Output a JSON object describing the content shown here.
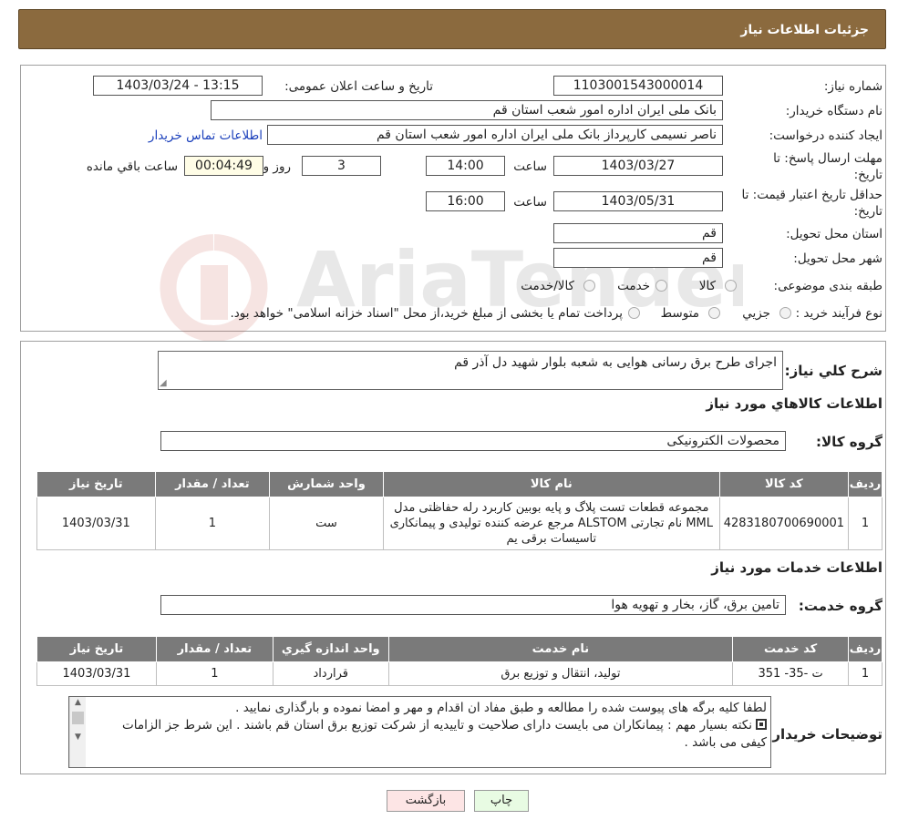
{
  "header": {
    "title": "جزئیات اطلاعات نیاز"
  },
  "need_info": {
    "need_number_label": "شماره نیاز:",
    "need_number": "1103001543000014",
    "announce_label": "تاریخ و ساعت اعلان عمومی:",
    "announce_value": "1403/03/24 - 13:15",
    "buyer_org_label": "نام دستگاه خریدار:",
    "buyer_org": "بانک ملی ایران اداره امور شعب استان قم",
    "creator_label": "ایجاد کننده درخواست:",
    "creator": "ناصر  نسیمی  کارپرداز  بانک ملی ایران اداره امور شعب استان قم",
    "contact_link": "اطلاعات تماس خریدار",
    "deadline_label": "مهلت ارسال پاسخ: تا تاریخ:",
    "deadline_date": "1403/03/27",
    "time_word": "ساعت",
    "deadline_time": "14:00",
    "days": "3",
    "days_word": "روز و",
    "remaining": "00:04:49",
    "remaining_word": "ساعت باقي مانده",
    "validity_label": "حداقل تاریخ اعتبار قیمت: تا تاریخ:",
    "validity_date": "1403/05/31",
    "validity_time": "16:00",
    "province_label": "استان محل تحویل:",
    "province": "قم",
    "city_label": "شهر محل تحویل:",
    "city": "قم",
    "category_label": "طبقه بندی موضوعی:",
    "category_options": [
      "کالا",
      "خدمت",
      "کالا/خدمت"
    ],
    "process_label": "نوع فرآیند خرید :",
    "process_options": [
      "جزيي",
      "متوسط"
    ],
    "process_note": "پرداخت تمام یا بخشی از مبلغ خرید،از محل \"اسناد خزانه اسلامی\" خواهد بود."
  },
  "description": {
    "label": "شرح کلي نياز:",
    "value": "اجرای طرح برق رسانی هوایی به شعبه بلوار شهید دل آذر قم"
  },
  "goods": {
    "section_title": "اطلاعات کالاهاي مورد نياز",
    "group_label": "گروه کالا:",
    "group_value": "محصولات الکترونیکی",
    "columns": [
      "رديف",
      "کد کالا",
      "نام کالا",
      "واحد شمارش",
      "تعداد / مقدار",
      "تاريخ نياز"
    ],
    "rows": [
      {
        "row": "1",
        "code": "4283180700690001",
        "name": "مجموعه قطعات تست پلاگ و پایه بوبین کاربرد رله حفاظتی مدل MML نام تجارتی ALSTOM مرجع عرضه کننده تولیدی و پیمانکاری تاسیسات برقی یم",
        "unit": "ست",
        "qty": "1",
        "date": "1403/03/31"
      }
    ]
  },
  "services": {
    "section_title": "اطلاعات خدمات مورد نياز",
    "group_label": "گروه خدمت:",
    "group_value": "تامین برق، گاز، بخار و تهویه هوا",
    "columns": [
      "رديف",
      "کد خدمت",
      "نام خدمت",
      "واحد اندازه گيري",
      "تعداد / مقدار",
      "تاريخ نياز"
    ],
    "rows": [
      {
        "row": "1",
        "code": "ت -35- 351",
        "name": "تولید، انتقال و توزیع برق",
        "unit": "قرارداد",
        "qty": "1",
        "date": "1403/03/31"
      }
    ]
  },
  "buyer_notes": {
    "label": "توضيحات خريدار:",
    "line1": "لطفا کلیه برگه های پیوست شده را مطالعه و طبق مفاد ان اقدام و مهر و امضا نموده و بارگذاری نمایید .",
    "line2": "نکته بسیار مهم : پیمانکاران می بایست دارای صلاحیت و تاییدیه از شرکت توزیع برق استان قم باشند . این شرط جز الزامات کیفی می باشد ."
  },
  "buttons": {
    "print": "چاپ",
    "back": "بازگشت"
  },
  "watermark": {
    "text": "AriaTender.neT"
  },
  "colors": {
    "header_bg": "#8b6a3e",
    "table_header": "#7a7a7a",
    "link": "#1a3fbb",
    "back_btn": "#fde5e5",
    "print_btn": "#e8fbe3"
  }
}
